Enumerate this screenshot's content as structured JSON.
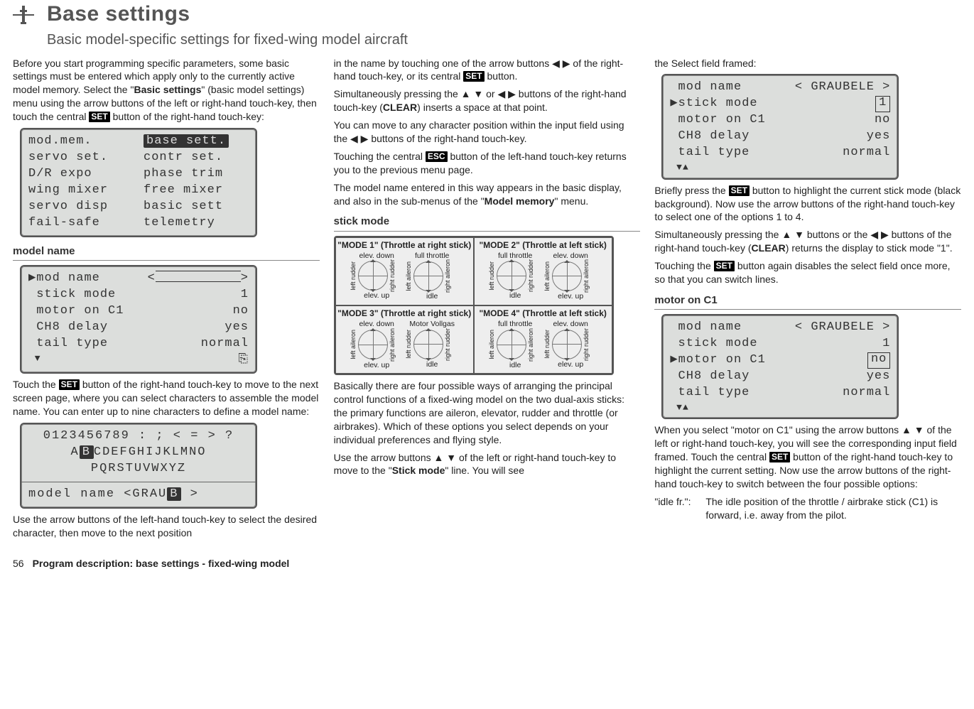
{
  "header": {
    "title": "Base settings",
    "subtitle": "Basic model-specific settings for fixed-wing model aircraft"
  },
  "col1": {
    "p1a": "Before you start programming specific parameters, some basic settings must be entered which apply only to the currently active model memory. Select the \"",
    "p1b": "Basic settings",
    "p1c": "\" (basic model settings) menu using the arrow buttons of the left or right-hand touch-key, then touch the central ",
    "p1d": " button of the right-hand touch-key:",
    "menu": {
      "left": [
        "mod.mem.",
        "servo set.",
        "D/R expo",
        "wing mixer",
        "servo disp",
        "fail-safe"
      ],
      "right": [
        "base sett.",
        "contr set.",
        "phase trim",
        "free mixer",
        "basic sett",
        "telemetry"
      ]
    },
    "sec_model_name": "model name",
    "lcd2": {
      "r0l": "mod name",
      "r0r": "",
      "r1l": "stick mode",
      "r1r": "1",
      "r2l": "motor on C1",
      "r2r": "no",
      "r3l": "CH8 delay",
      "r3r": "yes",
      "r4l": "tail type",
      "r4r": "normal"
    },
    "p2a": "Touch the ",
    "p2b": " button of the right-hand touch-key to move to the next screen page, where you can select characters to assemble the model name. You can enter up to nine characters to define a model name:",
    "lcd3": {
      "row1": "0123456789 : ; < = > ?",
      "row2a": " A",
      "row2b": "B",
      "row2c": "CDEFGHIJKLMNO",
      "row3": "PQRSTUVWXYZ",
      "row4a": "model name  ",
      "row4b": "<",
      "row4c": "GRAU",
      "row4d": "B",
      "row4e": "    >"
    },
    "p3": "Use the arrow buttons of the left-hand touch-key to select the desired character, then move to the next position"
  },
  "col2": {
    "p1a": "in the name by touching one of the arrow buttons ◀ ▶ of the right-hand touch-key, or its central ",
    "p1b": " button.",
    "p2a": "Simultaneously pressing the ▲ ▼ or ◀ ▶ buttons of the right-hand touch-key (",
    "p2b": "CLEAR",
    "p2c": ") inserts a space at that point.",
    "p3": "You can move to any character position within the input field using the ◀ ▶ buttons of the right-hand touch-key.",
    "p4a": "Touching the central ",
    "p4b": " button of the left-hand touch-key returns you to the previous menu page.",
    "p5a": "The model name entered in this way appears in the basic display, and also in the sub-menus of the \"",
    "p5b": "Model memory",
    "p5c": "\" menu.",
    "sec_stick": "stick mode",
    "modes": {
      "m1t": "\"MODE 1\" (Throttle at right stick)",
      "m2t": "\"MODE 2\" (Throttle at left stick)",
      "m3t": "\"MODE 3\" (Throttle at right stick)",
      "m4t": "\"MODE 4\" (Throttle at left stick)",
      "m1": {
        "l_top": "elev. down",
        "l_bot": "elev. up",
        "l_left": "left rudder",
        "l_right": "right rudder",
        "r_top": "full throttle",
        "r_bot": "idle",
        "r_left": "left aileron",
        "r_right": "right aileron"
      },
      "m2": {
        "l_top": "full throttle",
        "l_bot": "idle",
        "l_left": "left rudder",
        "l_right": "right rudder",
        "r_top": "elev. down",
        "r_bot": "elev. up",
        "r_left": "left aileron",
        "r_right": "right aileron"
      },
      "m3": {
        "l_top": "elev. down",
        "l_bot": "elev. up",
        "l_left": "left aileron",
        "l_right": "right aileron",
        "r_top": "Motor Vollgas",
        "r_bot": "idle",
        "r_left": "left rudder",
        "r_right": "right rudder"
      },
      "m4": {
        "l_top": "full throttle",
        "l_bot": "idle",
        "l_left": "left aileron",
        "l_right": "right aileron",
        "r_top": "elev. down",
        "r_bot": "elev. up",
        "r_left": "left rudder",
        "r_right": "right rudder"
      }
    },
    "p6": "Basically there are four possible ways of arranging the principal control functions of a fixed-wing model on the two dual-axis sticks: the primary functions are aileron, elevator, rudder and throttle (or airbrakes). Which of these options you select depends on your individual preferences and flying style.",
    "p7a": "Use the arrow buttons ▲ ▼ of the left or right-hand touch-key to move to the \"",
    "p7b": "Stick mode",
    "p7c": "\" line. You will see"
  },
  "col3": {
    "p1": "the Select field framed:",
    "lcdA": {
      "r0l": "mod name",
      "r0r": "< GRAUBELE >",
      "r1l": "▶stick mode",
      "r1r": "1",
      "r2l": " motor on C1",
      "r2r": "no",
      "r3l": " CH8 delay",
      "r3r": "yes",
      "r4l": " tail type",
      "r4r": "normal"
    },
    "p2a": "Briefly press the ",
    "p2b": " button to highlight the current stick mode (black background). Now use the arrow buttons of the right-hand touch-key to select one of the options 1 to 4.",
    "p3a": "Simultaneously pressing the ▲ ▼ buttons or the ◀ ▶ buttons of the right-hand touch-key (",
    "p3b": "CLEAR",
    "p3c": ") returns the display to stick mode \"1\".",
    "p4a": "Touching the ",
    "p4b": " button again disables the select field once more, so that you can switch lines.",
    "sec_motor": "motor on C1",
    "lcdB": {
      "r0l": " mod name",
      "r0r": "< GRAUBELE >",
      "r1l": " stick mode",
      "r1r": "1",
      "r2l": "▶motor on C1",
      "r2r": "no",
      "r3l": " CH8 delay",
      "r3r": "yes",
      "r4l": " tail type",
      "r4r": "normal"
    },
    "p5a": "When you select \"motor on C1\" using the arrow buttons ▲ ▼ of the left or right-hand touch-key, you will see the corresponding input field framed. Touch the central ",
    "p5b": " button of the right-hand touch-key to highlight the current setting. Now use the arrow buttons of the right-hand touch-key to switch between the four possible options:",
    "def_term": "\"idle fr.\":",
    "def_desc": "The idle position of the throttle / airbrake stick (C1) is forward, i.e. away from the pilot."
  },
  "footer": {
    "page": "56",
    "title": "Program description: base settings - fixed-wing model"
  },
  "keys": {
    "set": "SET",
    "esc": "ESC"
  }
}
